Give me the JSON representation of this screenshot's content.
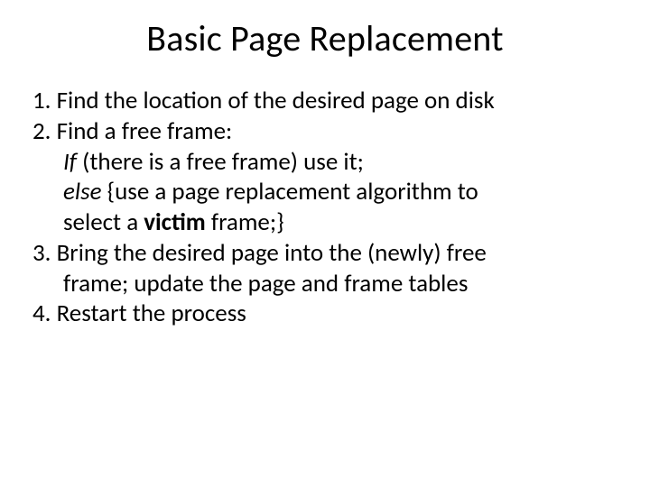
{
  "title": "Basic Page Replacement",
  "lines": {
    "l1": "1. Find the location of the desired page on disk",
    "l2": "2. Find a free frame:",
    "l3a": "If",
    "l3b": " (there is a free frame) use it;",
    "l4a": "else",
    "l4b": " {use a page replacement  algorithm to",
    "l5a": "select a ",
    "l5b": "victim",
    "l5c": " frame;}",
    "l6": "3. Bring  the desired page into the (newly) free",
    "l7": "frame; update the page and frame tables",
    "l8": "4. Restart the process"
  }
}
